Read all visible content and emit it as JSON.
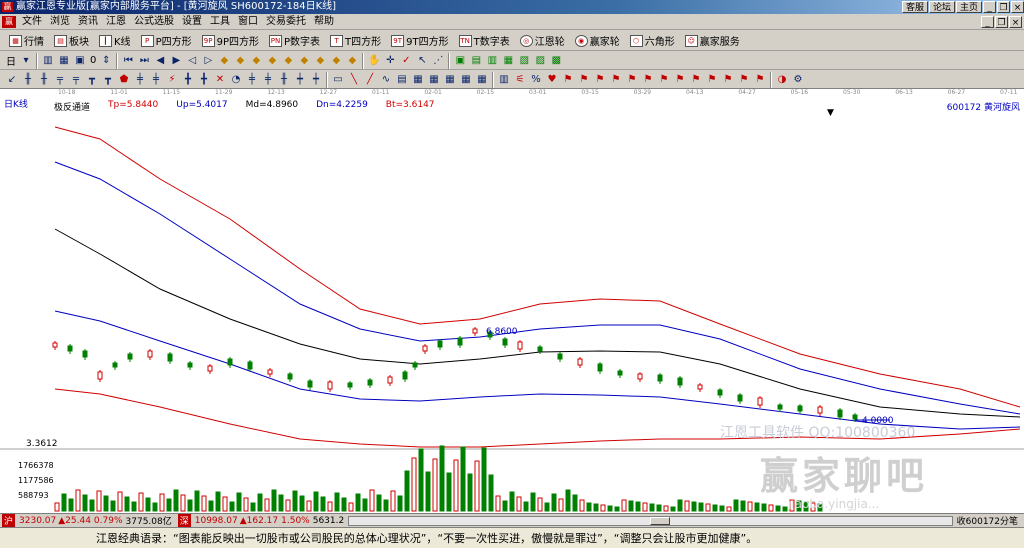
{
  "window": {
    "app_icon": "赢",
    "title": "赢家江恩专业版[赢家内部服务平台] - [黄河旋风  SH600172-184日K线]",
    "right_buttons": [
      "客服",
      "论坛",
      "主页"
    ]
  },
  "menu": {
    "logo": "赢",
    "items": [
      "文件",
      "浏览",
      "资讯",
      "江恩",
      "公式选股",
      "设置",
      "工具",
      "窗口",
      "交易委托",
      "帮助"
    ]
  },
  "toolbar1": {
    "items": [
      {
        "label": "行情",
        "icon": "grid-icon"
      },
      {
        "label": "板块",
        "icon": "block-icon"
      },
      {
        "label": "K线",
        "icon": "kline-icon"
      },
      {
        "label": "P四方形",
        "icon": "p-square-icon"
      },
      {
        "label": "9P四方形",
        "icon": "9p-square-icon"
      },
      {
        "label": "P数字表",
        "icon": "p-table-icon"
      },
      {
        "label": "T四方形",
        "icon": "t-square-icon"
      },
      {
        "label": "9T四方形",
        "icon": "9t-square-icon"
      },
      {
        "label": "T数字表",
        "icon": "t-table-icon"
      },
      {
        "label": "江恩轮",
        "icon": "gann-wheel-icon"
      },
      {
        "label": "赢家轮",
        "icon": "winner-wheel-icon"
      },
      {
        "label": "六角形",
        "icon": "hexagon-icon"
      },
      {
        "label": "赢家服务",
        "icon": "service-icon"
      }
    ]
  },
  "toolbar2": {
    "period_select": "日",
    "stepper": "0"
  },
  "chart_header": {
    "period_label": "日K线",
    "indicator_name": "极反通道",
    "tp": "Tp=5.8440",
    "up": "Up=5.4017",
    "md": "Md=4.8960",
    "dn": "Dn=4.2259",
    "bt": "Bt=3.6147",
    "stock": "600172  黄河旋风"
  },
  "chart_data": {
    "type": "line",
    "price_high_label": "6.8600",
    "price_low_label": "4.0000",
    "left_axis_label": "3.3612",
    "volume_ticks": [
      "1766378",
      "1177586",
      "588793"
    ],
    "date_ticks": [
      "10-18",
      "11-01",
      "11-15",
      "11-29",
      "12-13",
      "12-27",
      "01-11",
      "02-01",
      "02-15",
      "03-01",
      "03-15",
      "03-29",
      "04-13",
      "04-27",
      "05-16",
      "05-30",
      "06-13",
      "06-27",
      "07-11"
    ],
    "series": [
      {
        "color": "#d00000"
      },
      {
        "color": "#0000c0"
      },
      {
        "color": "#000000"
      },
      {
        "color": "#0000c0"
      },
      {
        "color": "#d00000"
      }
    ]
  },
  "watermark": {
    "line1": "江恩工具软件  QQ:100800360",
    "brand": "赢家聊吧",
    "url": "jiaoba.yingjia..."
  },
  "status": {
    "index1": "3230.07",
    "change1": "▲25.44",
    "pct1": "0.79%",
    "amount1": "3775.08亿",
    "index2": "10998.07",
    "change2": "▲162.17",
    "pct2": "1.50%",
    "amount2": "5631.2",
    "right": "收600172分笔"
  },
  "quote_bar": "江恩经典语录：“图表能反映出一切股市或公司股民的总体心理状况”，“不要一次性买进，傲慢就是罪过”，“调整只会让股市更加健康”。"
}
